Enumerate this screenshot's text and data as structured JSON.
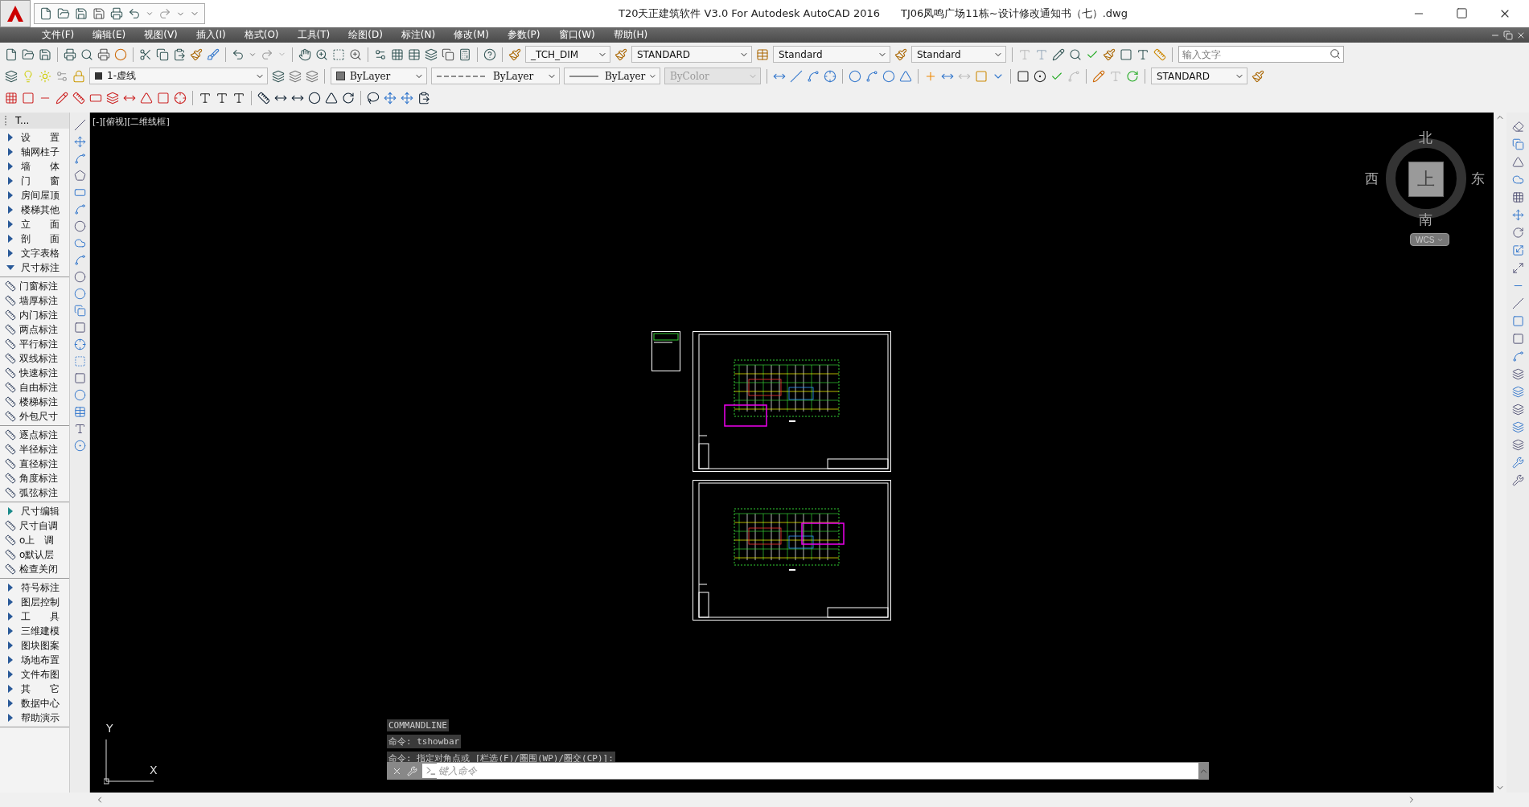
{
  "window": {
    "app_title": "T20天正建筑软件 V3.0 For Autodesk AutoCAD 2016",
    "file_name": "TJ06凤鸣广场11栋~设计修改通知书（七）.dwg"
  },
  "menu": [
    "文件(F)",
    "编辑(E)",
    "视图(V)",
    "插入(I)",
    "格式(O)",
    "工具(T)",
    "绘图(D)",
    "标注(N)",
    "修改(M)",
    "参数(P)",
    "窗口(W)",
    "帮助(H)"
  ],
  "toolbar": {
    "dim_style": "_TCH_DIM",
    "text_style": "STANDARD",
    "table_style": "Standard",
    "multileader_style": "Standard",
    "search_placeholder": "输入文字"
  },
  "layers_bar": {
    "layer": "1-虚线",
    "color_setting": "ByLayer",
    "linetype": "ByLayer",
    "lineweight": "ByLayer",
    "plot_style": {
      "label": "ByColor",
      "disabled": true
    },
    "dim_style": "STANDARD"
  },
  "sidebar": {
    "title": "T...",
    "sections": [
      {
        "items": [
          {
            "kind": "group",
            "label": "设　　置",
            "expanded": false
          },
          {
            "kind": "group",
            "label": "轴网柱子",
            "expanded": false
          },
          {
            "kind": "group",
            "label": "墙　　体",
            "expanded": false
          },
          {
            "kind": "group",
            "label": "门　　窗",
            "expanded": false
          },
          {
            "kind": "group",
            "label": "房间屋顶",
            "expanded": false
          },
          {
            "kind": "group",
            "label": "楼梯其他",
            "expanded": false
          },
          {
            "kind": "group",
            "label": "立　　面",
            "expanded": false
          },
          {
            "kind": "group",
            "label": "剖　　面",
            "expanded": false
          },
          {
            "kind": "group",
            "label": "文字表格",
            "expanded": false
          },
          {
            "kind": "group",
            "label": "尺寸标注",
            "expanded": true
          }
        ]
      },
      {
        "items": [
          {
            "kind": "command",
            "label": "门窗标注"
          },
          {
            "kind": "command",
            "label": "墙厚标注"
          },
          {
            "kind": "command",
            "label": "内门标注"
          },
          {
            "kind": "command",
            "label": "两点标注"
          },
          {
            "kind": "command",
            "label": "平行标注"
          },
          {
            "kind": "command",
            "label": "双线标注"
          },
          {
            "kind": "command",
            "label": "快速标注"
          },
          {
            "kind": "command",
            "label": "自由标注"
          },
          {
            "kind": "command",
            "label": "楼梯标注"
          },
          {
            "kind": "command",
            "label": "外包尺寸"
          }
        ]
      },
      {
        "items": [
          {
            "kind": "command",
            "label": "逐点标注"
          },
          {
            "kind": "command",
            "label": "半径标注"
          },
          {
            "kind": "command",
            "label": "直径标注"
          },
          {
            "kind": "command",
            "label": "角度标注"
          },
          {
            "kind": "command",
            "label": "弧弦标注"
          }
        ]
      },
      {
        "items": [
          {
            "kind": "subgroup",
            "label": "尺寸编辑",
            "expanded": false
          },
          {
            "kind": "command",
            "label": "尺寸自调"
          },
          {
            "kind": "command",
            "label": "o上　调"
          },
          {
            "kind": "command",
            "label": "o默认层"
          },
          {
            "kind": "command",
            "label": "检查关闭"
          }
        ]
      },
      {
        "items": [
          {
            "kind": "group",
            "label": "符号标注",
            "expanded": false
          },
          {
            "kind": "group",
            "label": "图层控制",
            "expanded": false
          },
          {
            "kind": "group",
            "label": "工　　具",
            "expanded": false
          },
          {
            "kind": "group",
            "label": "三维建模",
            "expanded": false
          },
          {
            "kind": "group",
            "label": "图块图案",
            "expanded": false
          },
          {
            "kind": "group",
            "label": "场地布置",
            "expanded": false
          },
          {
            "kind": "group",
            "label": "文件布图",
            "expanded": false
          },
          {
            "kind": "group",
            "label": "其　　它",
            "expanded": false
          },
          {
            "kind": "group",
            "label": "数据中心",
            "expanded": false
          },
          {
            "kind": "group",
            "label": "帮助演示",
            "expanded": false
          }
        ]
      }
    ]
  },
  "viewport": {
    "label": "[-][俯视][二维线框]",
    "compass": {
      "north": "北",
      "south": "南",
      "east": "东",
      "west": "西",
      "top": "上",
      "ucs": "WCS"
    },
    "axes": {
      "x": "X",
      "y": "Y"
    }
  },
  "command_line": {
    "header": "COMMANDLINE",
    "history": [
      "命令: tshowbar",
      "命令: 指定对角点或 [栏选(F)/圈围(WP)/圈交(CP)]:"
    ],
    "placeholder": "键入命令"
  }
}
